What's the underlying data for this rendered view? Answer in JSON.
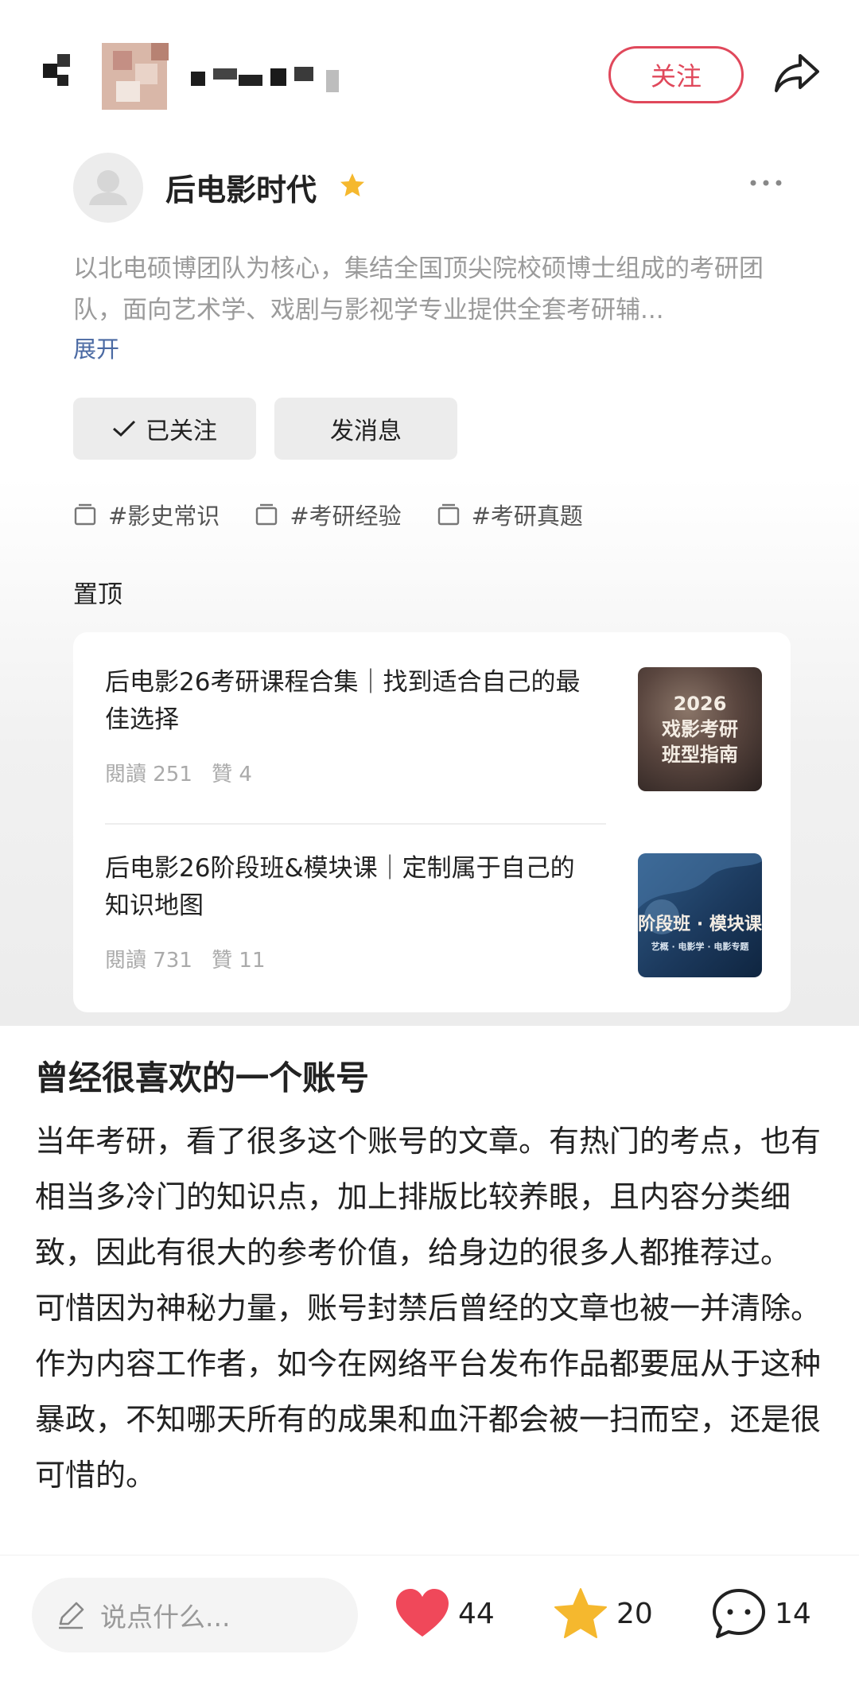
{
  "header": {
    "follow_label": "关注",
    "icons": {
      "share": "share-icon",
      "back": "pixelated-avatar"
    }
  },
  "profile": {
    "name": "后电影时代",
    "bio": "以北电硕博团队为核心，集结全国顶尖院校硕博士组成的考研团队，面向艺术学、戏剧与影视学专业提供全套考研辅...",
    "expand_label": "展开",
    "followed_label": "已关注",
    "message_label": "发消息",
    "tags": [
      "#影史常识",
      "#考研经验",
      "#考研真题"
    ]
  },
  "pinned": {
    "label": "置顶",
    "items": [
      {
        "title": "后电影26考研课程合集｜找到适合自己的最佳选择",
        "reads": "閱讀 251",
        "likes": "贊 4",
        "thumb_lines": [
          "2026",
          "戏影考研",
          "班型指南"
        ]
      },
      {
        "title": "后电影26阶段班&模块课｜定制属于自己的知识地图",
        "reads": "閱讀 731",
        "likes": "贊 11",
        "thumb_title": "阶段班 · 模块课",
        "thumb_sub": "艺概 · 电影学 · 电影专题"
      }
    ]
  },
  "post": {
    "title": "曾经很喜欢的一个账号",
    "paragraph1": "当年考研，看了很多这个账号的文章。有热门的考点，也有相当多冷门的知识点，加上排版比较养眼，且内容分类细致，因此有很大的参考价值，给身边的很多人都推荐过。",
    "paragraph2": "可惜因为神秘力量，账号封禁后曾经的文章也被一并清除。作为内容工作者，如今在网络平台发布作品都要屈从于这种暴政，不知哪天所有的成果和血汗都会被一扫而空，还是很可惜的。"
  },
  "bottom_bar": {
    "comment_placeholder": "说点什么...",
    "like_count": "44",
    "favorite_count": "20",
    "comment_count": "14"
  },
  "colors": {
    "accent_red": "#e0485b",
    "heart_red": "#f0485a",
    "star_yellow": "#f5b82e",
    "link_blue": "#4b6aa3"
  }
}
